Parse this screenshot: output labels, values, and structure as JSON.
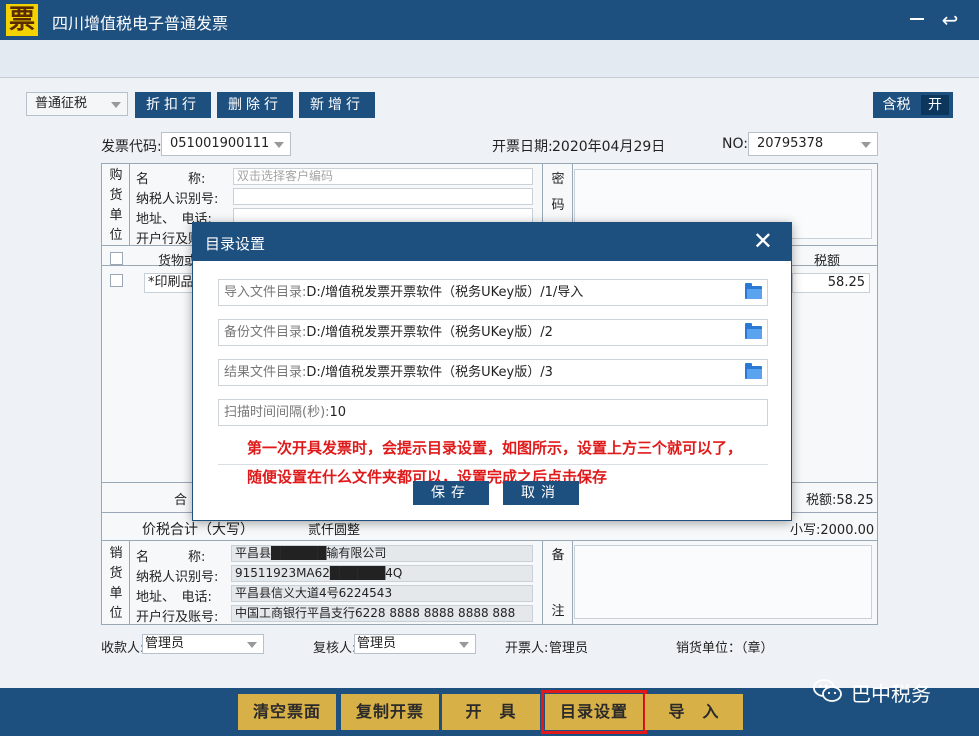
{
  "window": {
    "title": "四川增值税电子普通发票",
    "logo_char": "票",
    "back_glyph": "↩"
  },
  "toolbar": {
    "tax_type": "普通征税",
    "btn_discount": "折扣行",
    "btn_delete": "删除行",
    "btn_add": "新增行",
    "tax_toggle_label": "含税",
    "tax_toggle_state": "开"
  },
  "invoice_meta": {
    "code_label": "发票代码:",
    "code_value": "051001900111",
    "date_label": "开票日期:",
    "date_value": "2020年04月29日",
    "no_label": "NO:",
    "no_value": "20795378"
  },
  "buyer": {
    "side_label": [
      "购",
      "货",
      "单",
      "位"
    ],
    "name_label": "名　　　称:",
    "name_placeholder": "双击选择客户编码",
    "taxid_label": "纳税人识别号:",
    "addr_label": "地址、　电话:",
    "bank_label": "开户行及账号",
    "cipher_label": [
      "密",
      "码"
    ]
  },
  "items": {
    "col_goods": "货物或",
    "col_tax": "税额",
    "row1_goods": "*印刷品",
    "row1_tax": "58.25"
  },
  "totals": {
    "subtotal_label": "合",
    "tax_total": "税额:58.25",
    "grand_label": "价税合计（大写）",
    "grand_upper": "贰仟圆整",
    "grand_lower": "小写:2000.00"
  },
  "seller": {
    "side_label": [
      "销",
      "货",
      "单",
      "位"
    ],
    "name_label": "名　　　称:",
    "name_value": "平昌县██████输有限公司",
    "taxid_label": "纳税人识别号:",
    "taxid_value": "91511923MA62██████4Q",
    "addr_label": "地址、　电话:",
    "addr_value": "平昌县信义大道4号6224543",
    "bank_label": "开户行及账号:",
    "bank_value": "中国工商银行平昌支行6228 8888 8888 8888 888",
    "remark_label": [
      "备",
      "注"
    ]
  },
  "signers": {
    "payee_label": "收款人:",
    "payee_value": "管理员",
    "reviewer_label": "复核人:",
    "reviewer_value": "管理员",
    "drawer_label": "开票人:",
    "drawer_value": "管理员",
    "seller_seal": "销货单位：（章）"
  },
  "modal": {
    "title": "目录设置",
    "close_glyph": "✕",
    "import_label": "导入文件目录:",
    "import_value": "D:/增值税发票开票软件（税务UKey版）/1/导入",
    "backup_label": "备份文件目录:",
    "backup_value": "D:/增值税发票开票软件（税务UKey版）/2",
    "result_label": "结果文件目录:",
    "result_value": "D:/增值税发票开票软件（税务UKey版）/3",
    "scan_label": "扫描时间间隔(秒):",
    "scan_value": "10",
    "note_line1": "第一次开具发票时，会提示目录设置，如图所示，设置上方三个就可以了，",
    "note_line2": "随便设置在什么文件夹都可以，设置完成之后点击保存",
    "save_label": "保存",
    "cancel_label": "取消"
  },
  "bottom": {
    "clear": "清空票面",
    "copy": "复制开票",
    "issue": "开　具",
    "dirs": "目录设置",
    "import": "导　入",
    "watermark": "巴中税务"
  },
  "colors": {
    "primary": "#1d4f7f",
    "gold": "#d8b048",
    "annotation_red": "#e01a1a",
    "logo_yellow": "#f2d200"
  }
}
